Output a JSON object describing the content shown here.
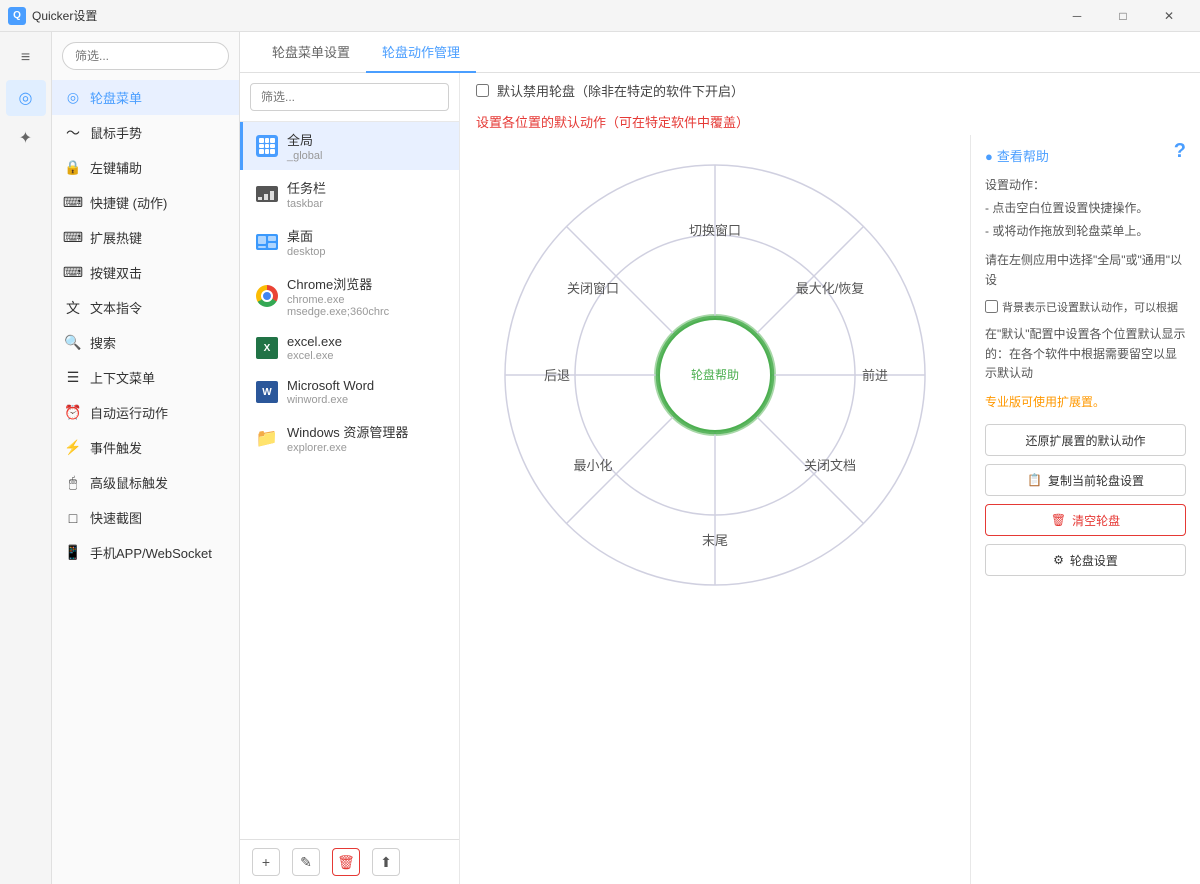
{
  "window": {
    "title": "Quicker设置",
    "controls": {
      "minimize": "─",
      "maximize": "□",
      "close": "✕"
    }
  },
  "iconbar": {
    "items": [
      {
        "name": "filter-icon",
        "symbol": "≡",
        "active": false
      },
      {
        "name": "wheel-icon",
        "symbol": "◎",
        "active": true
      },
      {
        "name": "settings-icon",
        "symbol": "✦",
        "active": false
      }
    ]
  },
  "nav": {
    "search_placeholder": "筛选...",
    "items": [
      {
        "id": "wheel-menu",
        "label": "轮盘菜单",
        "icon": "◎",
        "active": true
      },
      {
        "id": "mouse-gesture",
        "label": "鼠标手势",
        "icon": "〜"
      },
      {
        "id": "left-assist",
        "label": "左键辅助",
        "icon": "🔒"
      },
      {
        "id": "shortcuts",
        "label": "快捷键 (动作)",
        "icon": "⌨"
      },
      {
        "id": "ext-hotkey",
        "label": "扩展热键",
        "icon": "⌨"
      },
      {
        "id": "double-key",
        "label": "按键双击",
        "icon": "⌨"
      },
      {
        "id": "text-cmd",
        "label": "文本指令",
        "icon": "文"
      },
      {
        "id": "search",
        "label": "搜索",
        "icon": "🔍"
      },
      {
        "id": "context-menu",
        "label": "上下文菜单",
        "icon": "☰"
      },
      {
        "id": "auto-run",
        "label": "自动运行动作",
        "icon": "⏰"
      },
      {
        "id": "event-trigger",
        "label": "事件触发",
        "icon": "⚡"
      },
      {
        "id": "adv-mouse",
        "label": "高级鼠标触发",
        "icon": "🖱"
      },
      {
        "id": "screenshot",
        "label": "快速截图",
        "icon": "□"
      },
      {
        "id": "mobile-app",
        "label": "手机APP/WebSocket",
        "icon": "📱"
      }
    ]
  },
  "tabs": [
    {
      "id": "wheel-menu-settings",
      "label": "轮盘菜单设置",
      "active": false
    },
    {
      "id": "wheel-action-mgmt",
      "label": "轮盘动作管理",
      "active": true
    }
  ],
  "app_list": {
    "search_placeholder": "筛选...",
    "items": [
      {
        "id": "global",
        "name": "全局",
        "sub": "_global",
        "type": "grid",
        "active": true
      },
      {
        "id": "taskbar",
        "name": "任务栏",
        "sub": "taskbar",
        "type": "taskbar"
      },
      {
        "id": "desktop",
        "name": "桌面",
        "sub": "desktop",
        "type": "desktop"
      },
      {
        "id": "chrome",
        "name": "Chrome浏览器",
        "sub": "chrome.exe  msedge.exe;360chrc",
        "type": "chrome"
      },
      {
        "id": "excel",
        "name": "excel.exe",
        "sub": "excel.exe",
        "type": "excel"
      },
      {
        "id": "word",
        "name": "Microsoft Word",
        "sub": "winword.exe",
        "type": "word"
      },
      {
        "id": "explorer",
        "name": "Windows 资源管理器",
        "sub": "explorer.exe",
        "type": "folder"
      }
    ],
    "bottom_buttons": [
      {
        "id": "add-btn",
        "symbol": "+",
        "tooltip": "添加"
      },
      {
        "id": "edit-btn",
        "symbol": "✎",
        "tooltip": "编辑"
      },
      {
        "id": "delete-btn",
        "symbol": "🗑",
        "tooltip": "删除",
        "type": "delete"
      },
      {
        "id": "export-btn",
        "symbol": "⬆",
        "tooltip": "导出"
      }
    ]
  },
  "wheel": {
    "checkbox_label": "默认禁用轮盘（除非在特定的软件下开启）",
    "subtitle": "设置各位置的默认动作（可在特定软件中覆盖）",
    "center_label": "轮盘帮助",
    "segments": [
      {
        "id": "top",
        "label": "切换窗口",
        "angle": 90
      },
      {
        "id": "top-right",
        "label": "最大化/恢复",
        "angle": 45
      },
      {
        "id": "right",
        "label": "前进",
        "angle": 0
      },
      {
        "id": "bottom-right",
        "label": "关闭文档",
        "angle": 315
      },
      {
        "id": "bottom",
        "label": "末尾",
        "angle": 270
      },
      {
        "id": "bottom-left",
        "label": "最小化",
        "angle": 225
      },
      {
        "id": "left",
        "label": "后退",
        "angle": 180
      },
      {
        "id": "top-left",
        "label": "关闭窗口",
        "angle": 135
      }
    ]
  },
  "info_panel": {
    "help_link": "查看帮助",
    "help_text_title": "设置动作：",
    "help_text_lines": [
      "- 点击空白位置设置快捷操作。",
      "- 或将动作拖放到轮盘菜单上。"
    ],
    "instruction": "请在左侧应用中选择\"全局\"或\"通用\"以设",
    "checkbox_label": "背景表示已设置默认动作，可以根据",
    "default_note": "在\"默认\"配置中设置各个位置默认显示的：在各个软件中根据需要留空以显示默认动",
    "pro_text": "专业版可使用扩展置。",
    "buttons": [
      {
        "id": "restore-btn",
        "label": "还原扩展置的默认动作"
      },
      {
        "id": "copy-btn",
        "label": "复制当前轮盘设置",
        "icon": "📋"
      },
      {
        "id": "clear-btn",
        "label": "清空轮盘",
        "icon": "🗑",
        "type": "danger"
      },
      {
        "id": "wheel-settings-btn",
        "label": "轮盘设置",
        "icon": "⚙"
      }
    ]
  }
}
